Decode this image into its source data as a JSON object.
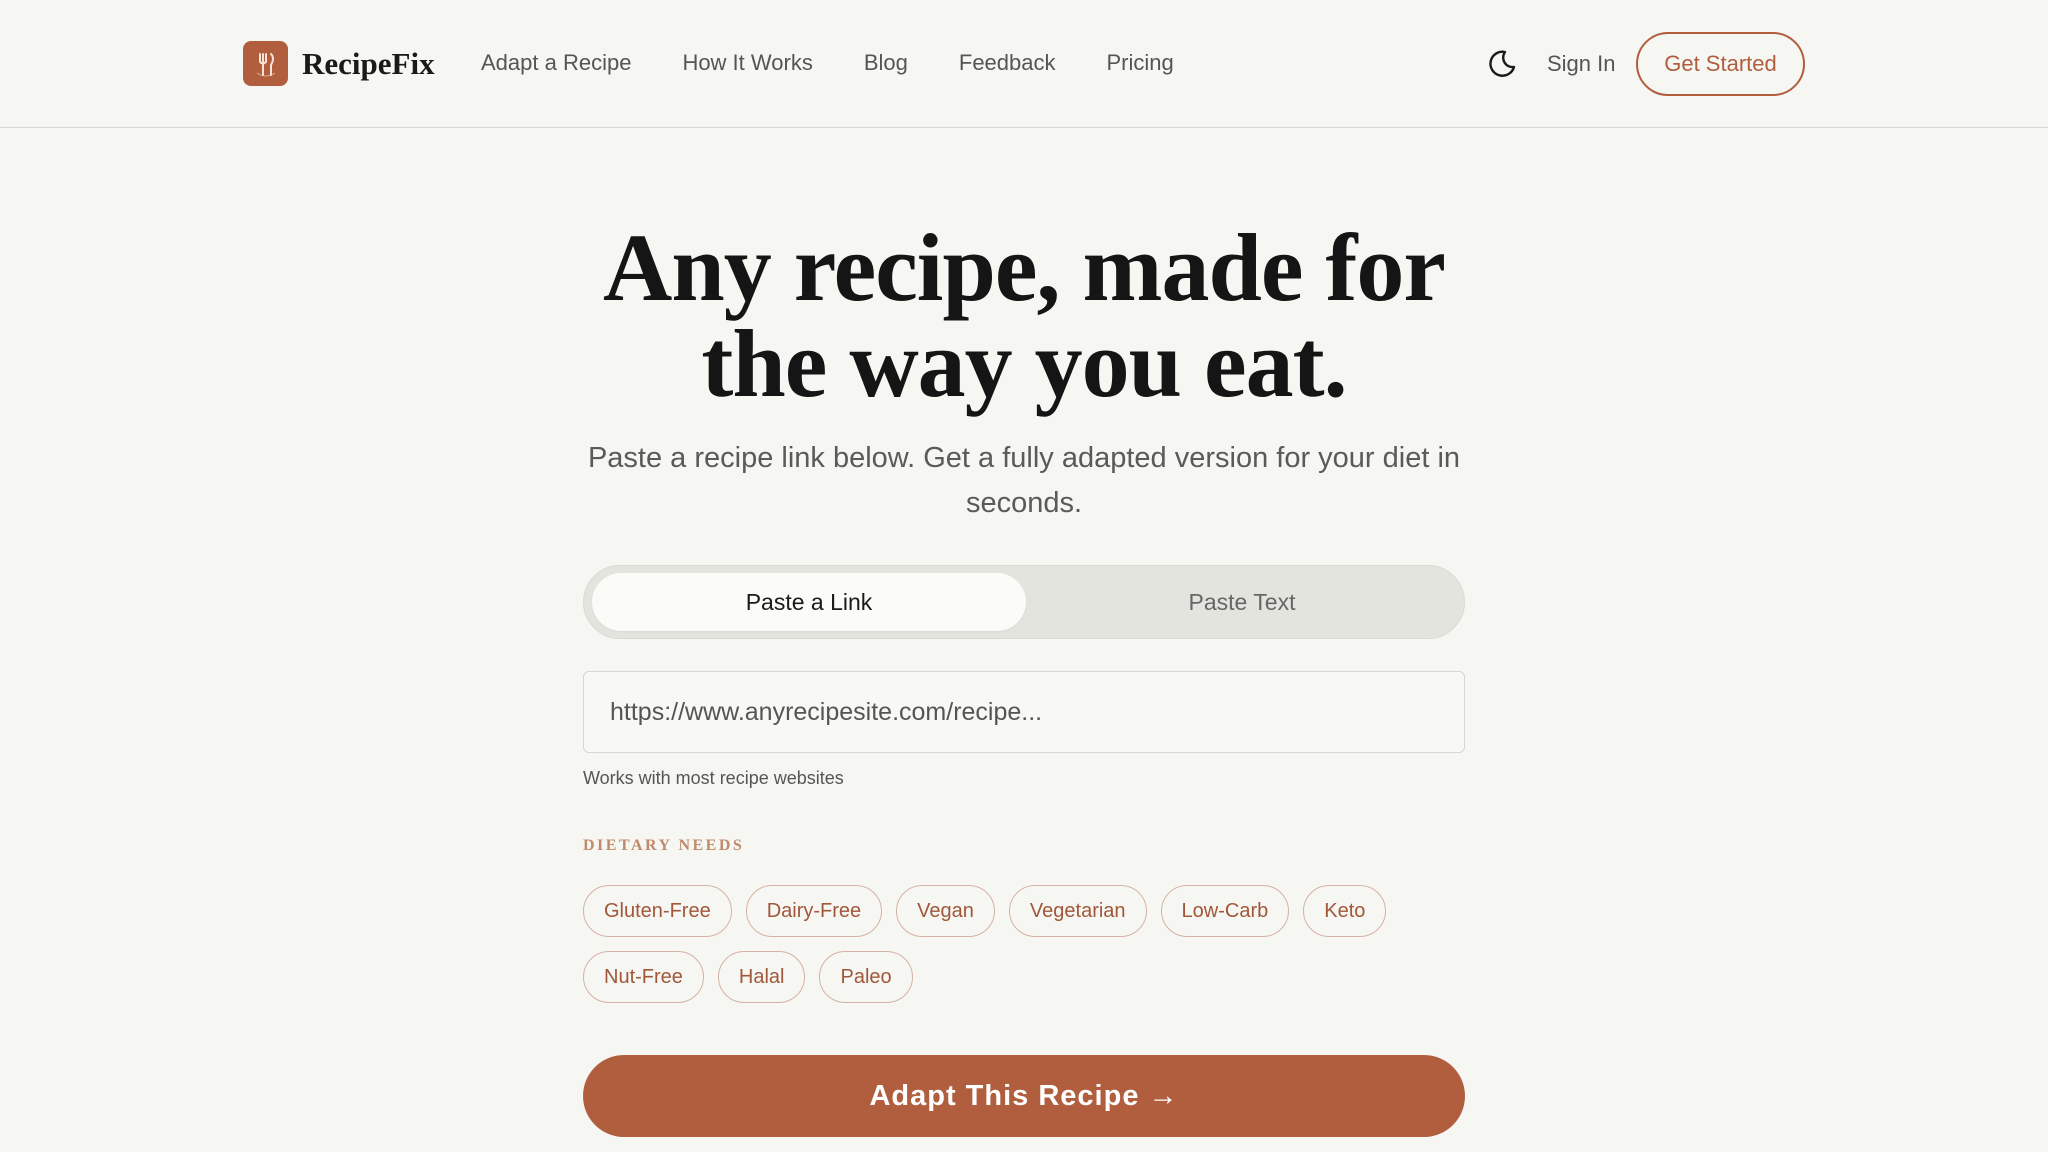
{
  "header": {
    "logo_text": "RecipeFix",
    "brand_color": "#b05e3e",
    "nav": [
      "Adapt a Recipe",
      "How It Works",
      "Blog",
      "Feedback",
      "Pricing"
    ],
    "theme_icon": "moon-icon",
    "sign_in": "Sign In",
    "get_started": "Get Started"
  },
  "hero": {
    "title_line1": "Any recipe, made for",
    "title_line2": "the way you eat.",
    "subtitle": "Paste a recipe link below. Get a fully adapted version for your diet in seconds."
  },
  "input_mode": {
    "options": [
      "Paste a Link",
      "Paste Text"
    ],
    "selected": "Paste a Link"
  },
  "url_field": {
    "placeholder": "https://www.anyrecipesite.com/recipe...",
    "value": "",
    "hint": "Works with most recipe websites"
  },
  "dietary": {
    "label": "DIETARY NEEDS",
    "row1": [
      "Gluten-Free",
      "Dairy-Free",
      "Vegan",
      "Vegetarian",
      "Low-Carb",
      "Keto"
    ],
    "row2": [
      "Nut-Free",
      "Halal",
      "Paleo"
    ]
  },
  "cta": {
    "label": "Adapt This Recipe →"
  }
}
